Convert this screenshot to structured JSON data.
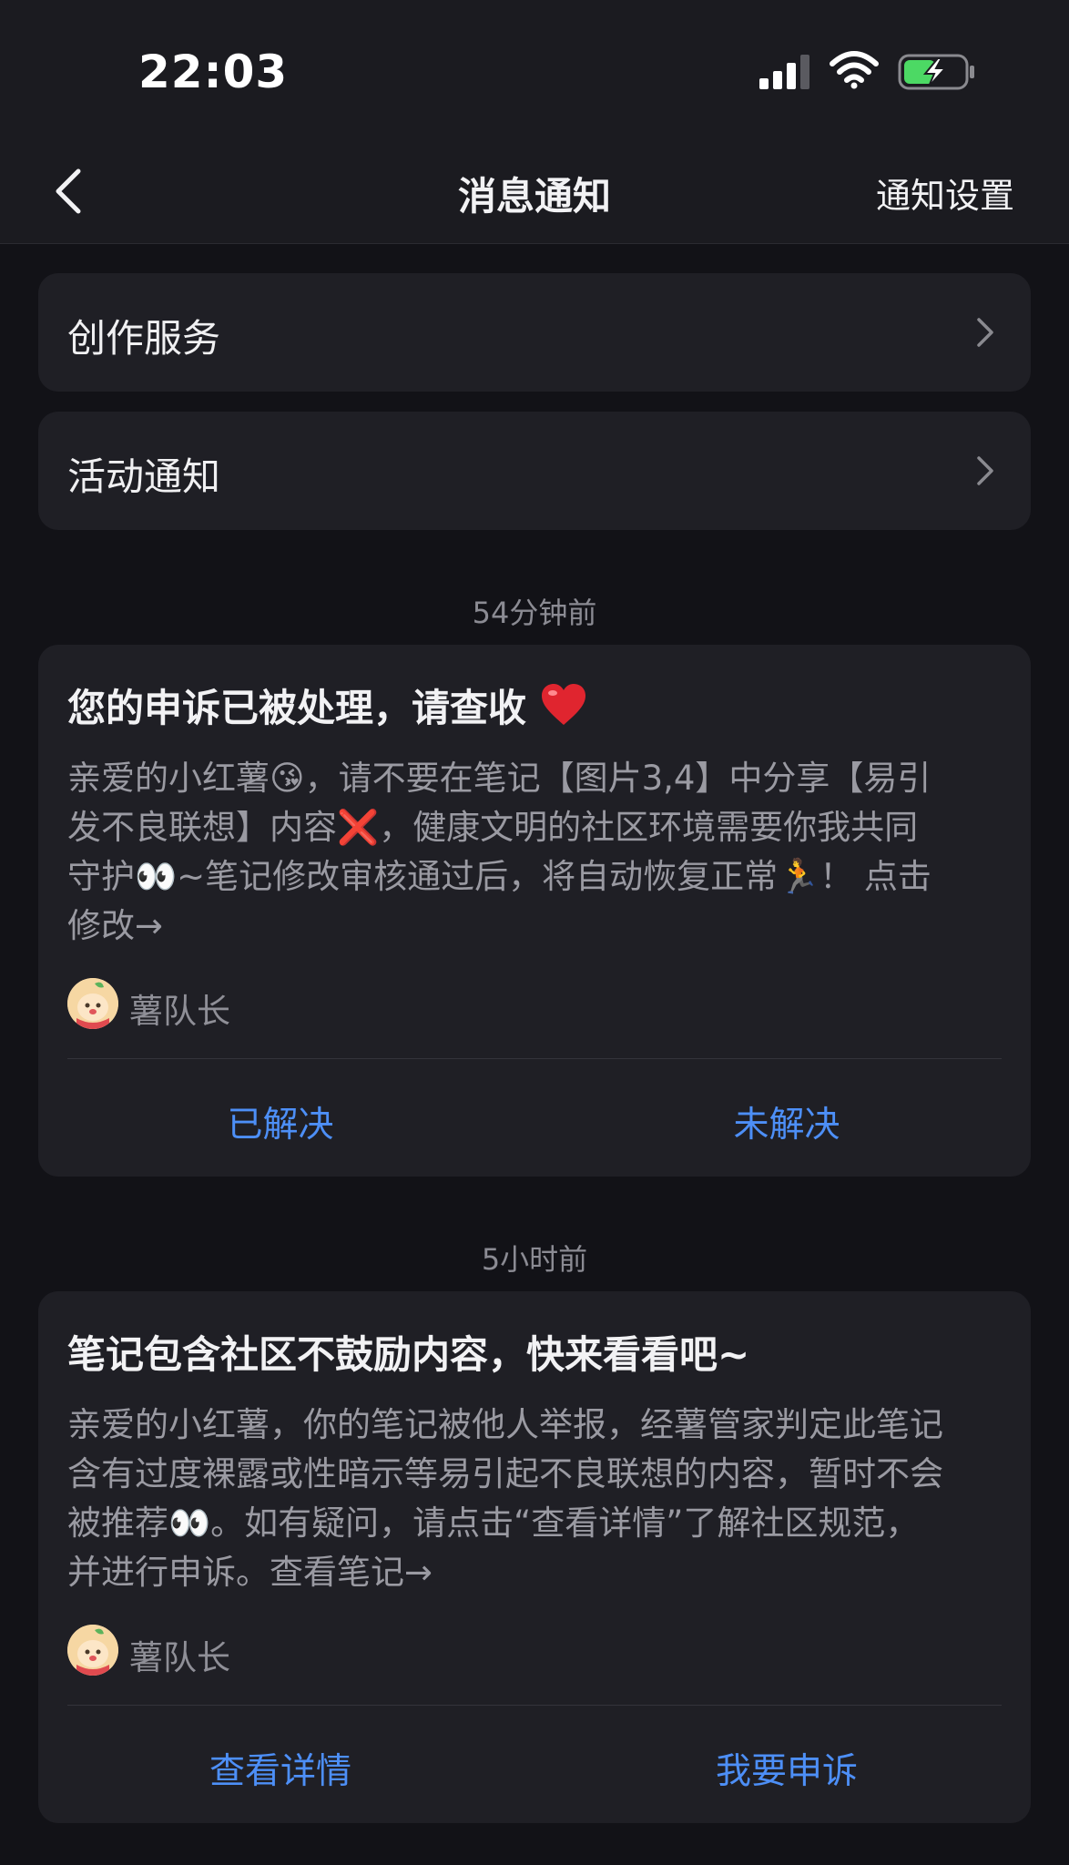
{
  "status_bar": {
    "time": "22:03"
  },
  "nav": {
    "title": "消息通知",
    "right_action": "通知设置"
  },
  "menu": [
    {
      "label": "创作服务"
    },
    {
      "label": "活动通知"
    }
  ],
  "notifications": [
    {
      "time_ago": "54分钟前",
      "title": "您的申诉已被处理，请查收",
      "body_lines": [
        "亲爱的小红薯😘，请不要在笔记【图片3,4】中分享【易引",
        "发不良联想】内容❌，健康文明的社区环境需要你我共同",
        "守护👀~笔记修改审核通过后，将自动恢复正常🏃！ 点击",
        "修改→"
      ],
      "sender": "薯队长",
      "actions": [
        "已解决",
        "未解决"
      ]
    },
    {
      "time_ago": "5小时前",
      "title": "笔记包含社区不鼓励内容，快来看看吧~",
      "body_lines": [
        "亲爱的小红薯，你的笔记被他人举报，经薯管家判定此笔记",
        "含有过度裸露或性暗示等易引起不良联想的内容，暂时不会",
        "被推荐👀。如有疑问，请点击“查看详情”了解社区规范，",
        "并进行申诉。查看笔记→"
      ],
      "sender": "薯队长",
      "actions": [
        "查看详情",
        "我要申诉"
      ]
    }
  ],
  "colors": {
    "accent": "#4d8ff7",
    "background": "#121217",
    "card": "#1f1f25"
  }
}
